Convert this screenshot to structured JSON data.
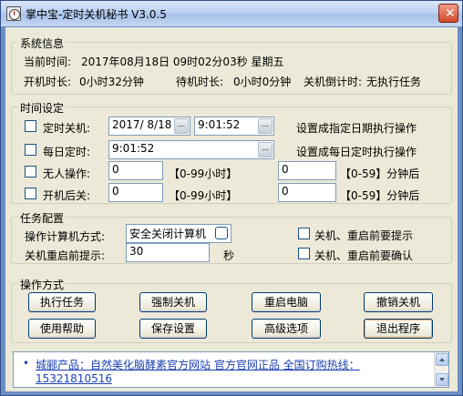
{
  "window": {
    "title": "掌中宝-定时关机秘书 V3.0.5",
    "close_glyph": "✕"
  },
  "system_info": {
    "title": "系统信息",
    "current_time_label": "当前时间:",
    "current_time_value": "2017年08月18日 09时02分03秒 星期五",
    "uptime_label": "开机时长:",
    "uptime_value": "0小时32分钟",
    "idle_label": "待机时长:",
    "idle_value": "0小时0分钟",
    "countdown_label": "关机倒计时:",
    "countdown_value": "无执行任务"
  },
  "time_settings": {
    "title": "时间设定",
    "timed_shutdown": {
      "label": "定时关机:",
      "date": "2017/ 8/18",
      "time": "9:01:52",
      "note": "设置成指定日期执行操作"
    },
    "daily": {
      "label": "每日定时:",
      "time": "9:01:52",
      "note": "设置成每日定时执行操作"
    },
    "unattended": {
      "label": "无人操作:",
      "hours": "0",
      "hours_range": "【0-99小时】",
      "minutes": "0",
      "minutes_range": "【0-59】分钟后"
    },
    "after_boot": {
      "label": "开机后关:",
      "hours": "0",
      "hours_range": "【0-99小时】",
      "minutes": "0",
      "minutes_range": "【0-59】分钟后"
    }
  },
  "task_config": {
    "title": "任务配置",
    "method_label": "操作计算机方式:",
    "method_value": "安全关闭计算机",
    "prompt_label": "关机重启前提示:",
    "prompt_value": "30",
    "prompt_unit": "秒",
    "opt_prompt": "关机、重启前要提示",
    "opt_confirm": "关机、重启前要确认"
  },
  "operations": {
    "title": "操作方式",
    "buttons": [
      "执行任务",
      "强制关机",
      "重启电脑",
      "撤销关机",
      "使用帮助",
      "保存设置",
      "高级选项",
      "退出程序"
    ]
  },
  "footer": {
    "bullet": "•",
    "link_line1": "城郦产品：自然美化脑酵素官方网站 官方官网正品 全国订购热线：",
    "link_line2": "15321810516"
  },
  "colors": {
    "frame": "#6c8fc6",
    "client": "#ece9d8",
    "link": "#1a3fb3",
    "close": "#d24a2a"
  }
}
